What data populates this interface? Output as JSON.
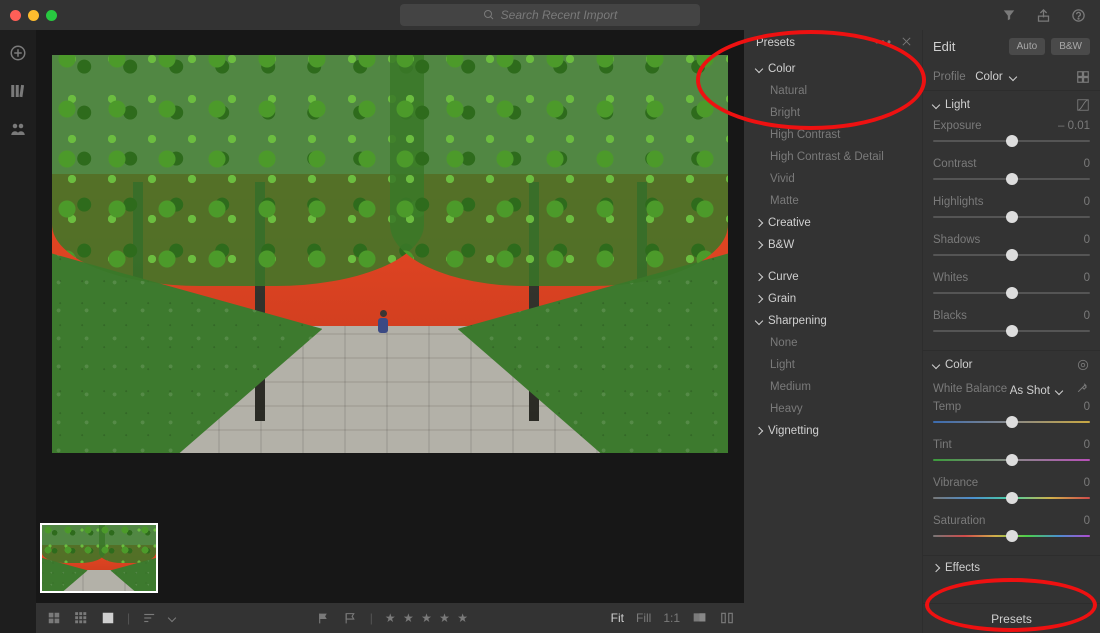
{
  "topbar": {
    "search_placeholder": "Search Recent Import"
  },
  "presets": {
    "title": "Presets",
    "groups": [
      {
        "label": "Color",
        "open": true,
        "items": [
          "Natural",
          "Bright",
          "High Contrast",
          "High Contrast & Detail",
          "Vivid",
          "Matte"
        ]
      },
      {
        "label": "Creative",
        "open": false,
        "items": []
      },
      {
        "label": "B&W",
        "open": false,
        "items": []
      },
      {
        "label": "Curve",
        "open": false,
        "items": []
      },
      {
        "label": "Grain",
        "open": false,
        "items": []
      },
      {
        "label": "Sharpening",
        "open": true,
        "items": [
          "None",
          "Light",
          "Medium",
          "Heavy"
        ]
      },
      {
        "label": "Vignetting",
        "open": false,
        "items": []
      }
    ]
  },
  "edit": {
    "title": "Edit",
    "auto_btn": "Auto",
    "bw_btn": "B&W",
    "profile_label": "Profile",
    "profile_value": "Color",
    "sections": {
      "light": {
        "label": "Light",
        "sliders": [
          {
            "name": "Exposure",
            "value": "– 0.01",
            "pos": 50
          },
          {
            "name": "Contrast",
            "value": "0",
            "pos": 50
          },
          {
            "name": "Highlights",
            "value": "0",
            "pos": 50
          },
          {
            "name": "Shadows",
            "value": "0",
            "pos": 50
          },
          {
            "name": "Whites",
            "value": "0",
            "pos": 50
          },
          {
            "name": "Blacks",
            "value": "0",
            "pos": 50
          }
        ]
      },
      "color": {
        "label": "Color",
        "wb_label": "White Balance",
        "wb_value": "As Shot",
        "sliders": [
          {
            "name": "Temp",
            "value": "0",
            "pos": 50,
            "track": "temp"
          },
          {
            "name": "Tint",
            "value": "0",
            "pos": 50,
            "track": "tint"
          },
          {
            "name": "Vibrance",
            "value": "0",
            "pos": 50,
            "track": "vib"
          },
          {
            "name": "Saturation",
            "value": "0",
            "pos": 50,
            "track": "sat"
          }
        ]
      },
      "effects": {
        "label": "Effects"
      }
    },
    "bottom_btn": "Presets"
  },
  "bottombar": {
    "fit": "Fit",
    "fill": "Fill",
    "onetoone": "1:1"
  }
}
